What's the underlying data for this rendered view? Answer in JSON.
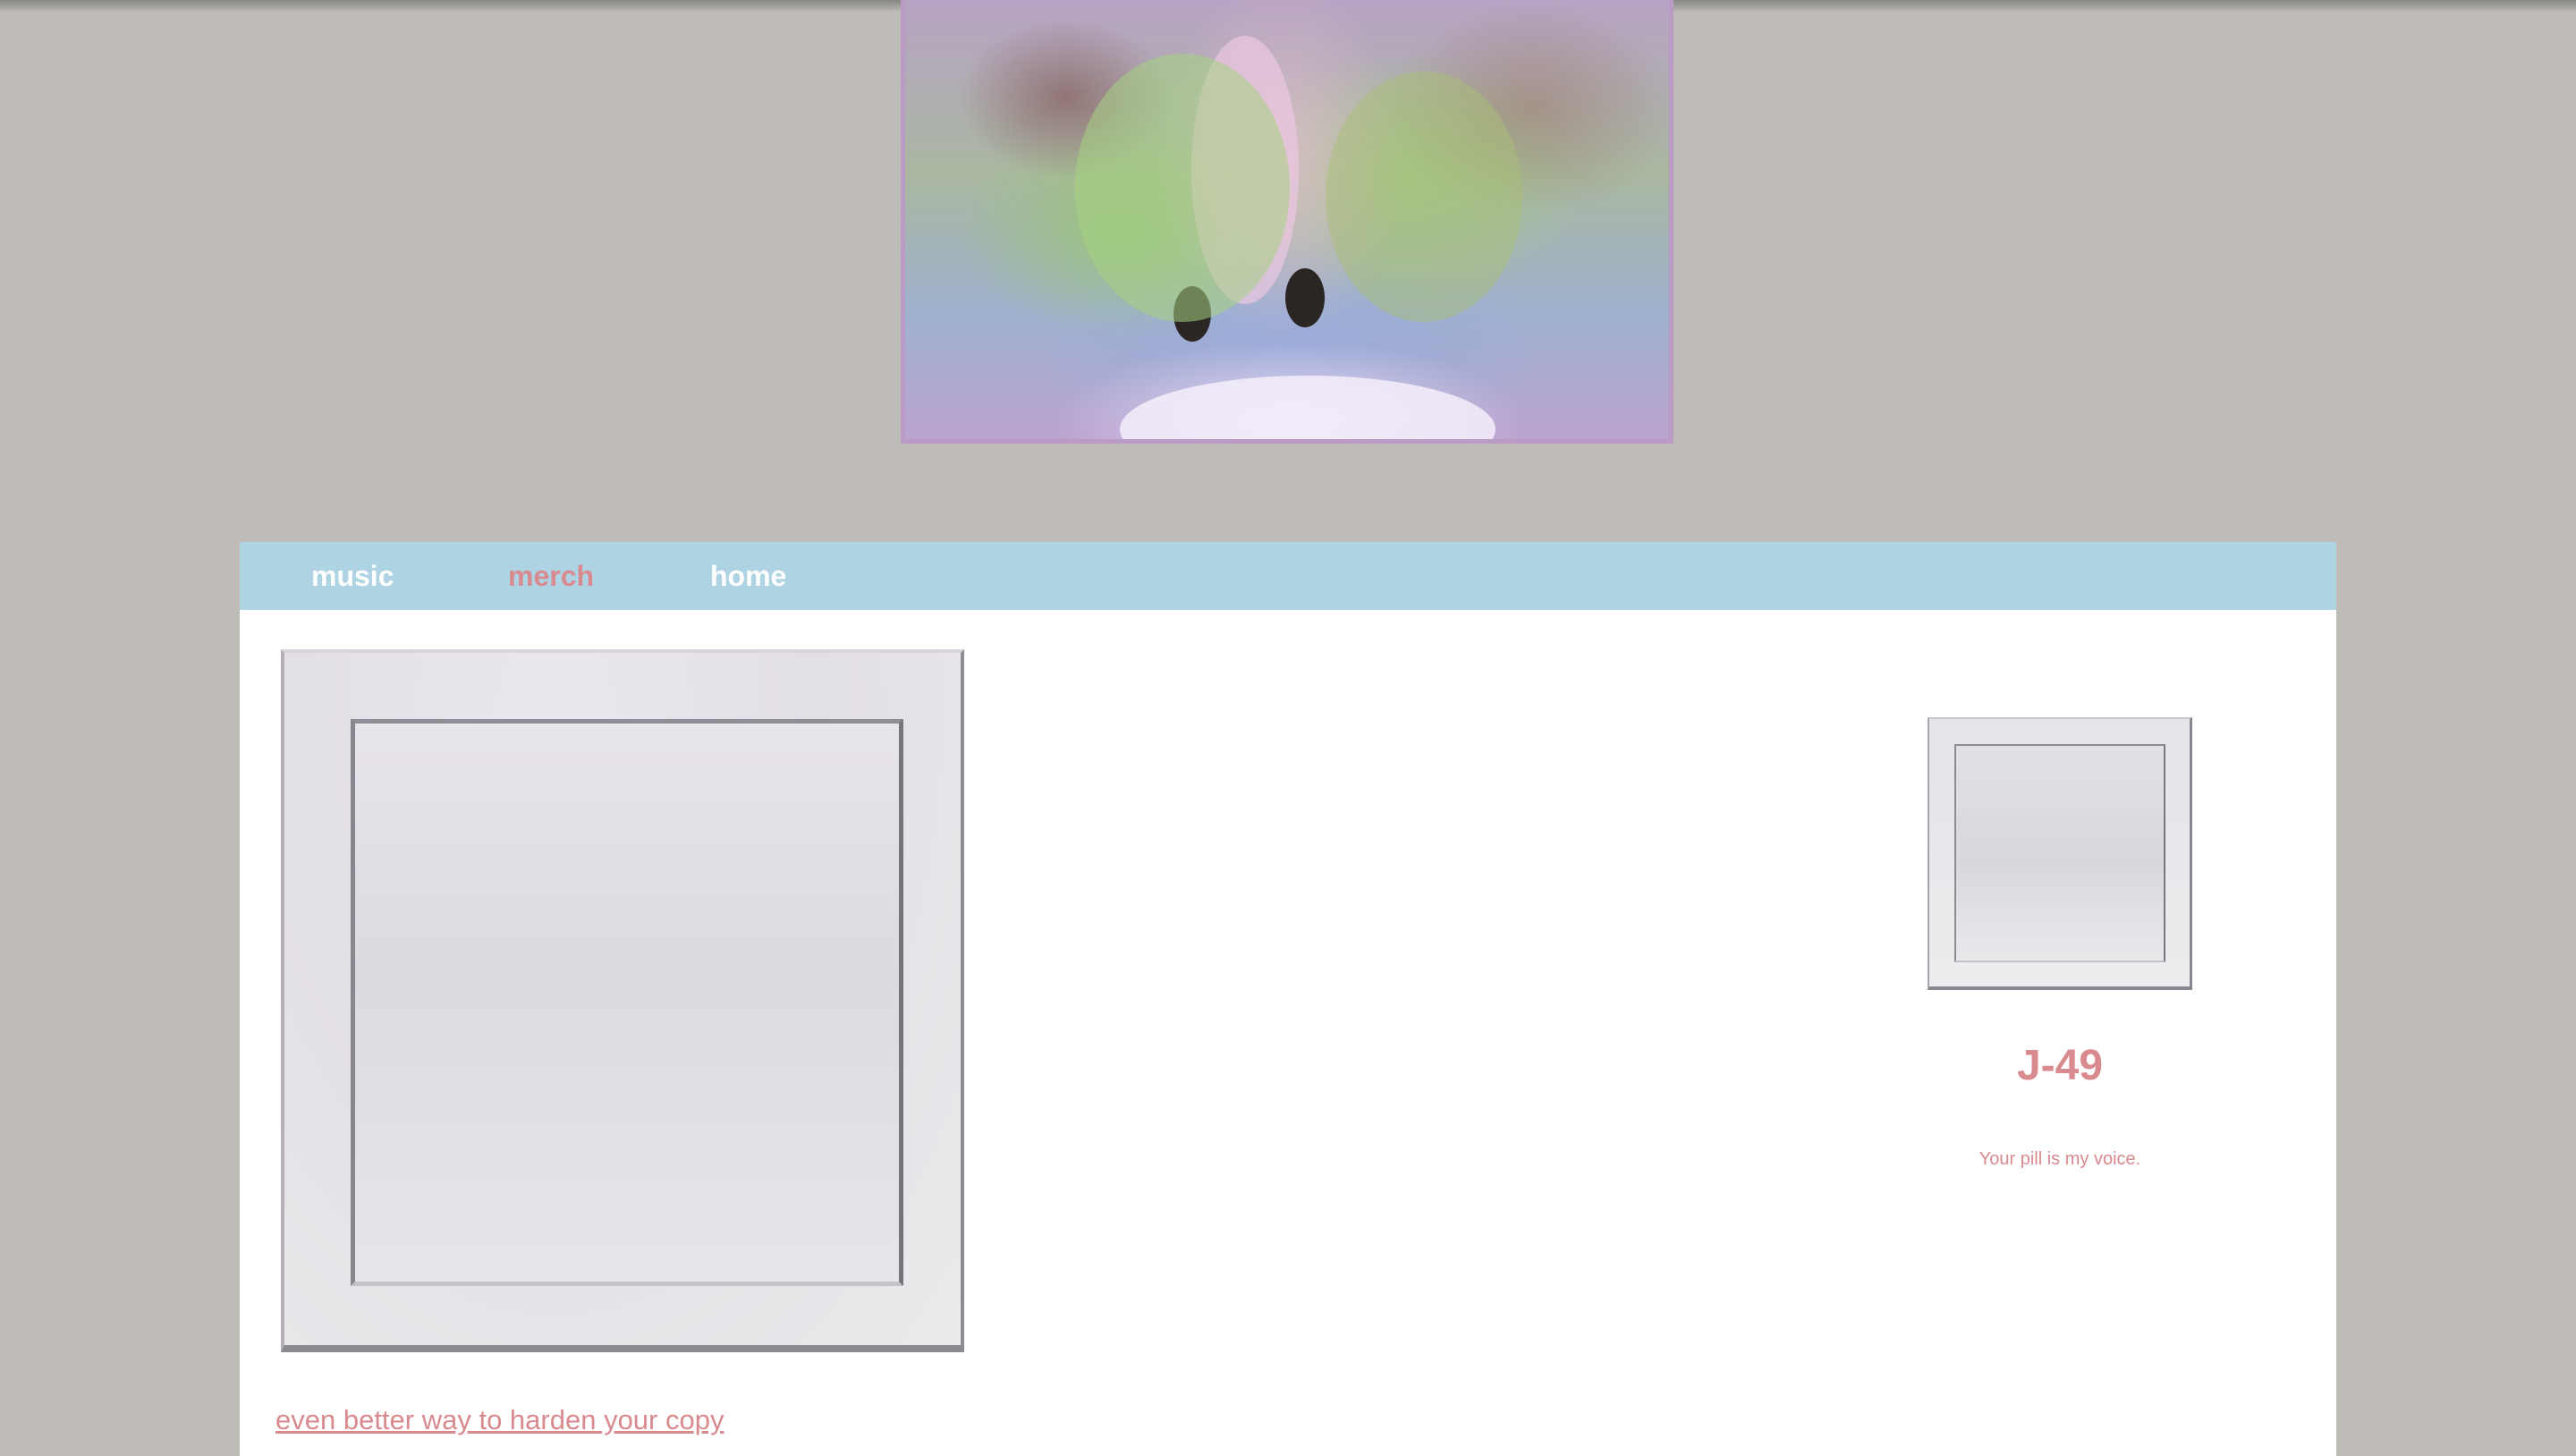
{
  "nav": {
    "items": [
      {
        "label": "music",
        "active": false
      },
      {
        "label": "merch",
        "active": true
      },
      {
        "label": "home",
        "active": false
      }
    ]
  },
  "artist": {
    "name": "J-49",
    "tagline": "Your pill is my voice."
  },
  "footer_link": {
    "label": "even better way to harden your copy"
  },
  "colors": {
    "page_background": "#bfbcb8",
    "nav_background": "#aed4e3",
    "nav_text": "#ffffff",
    "accent": "#d98a8f",
    "banner_border": "#b99bc5"
  }
}
